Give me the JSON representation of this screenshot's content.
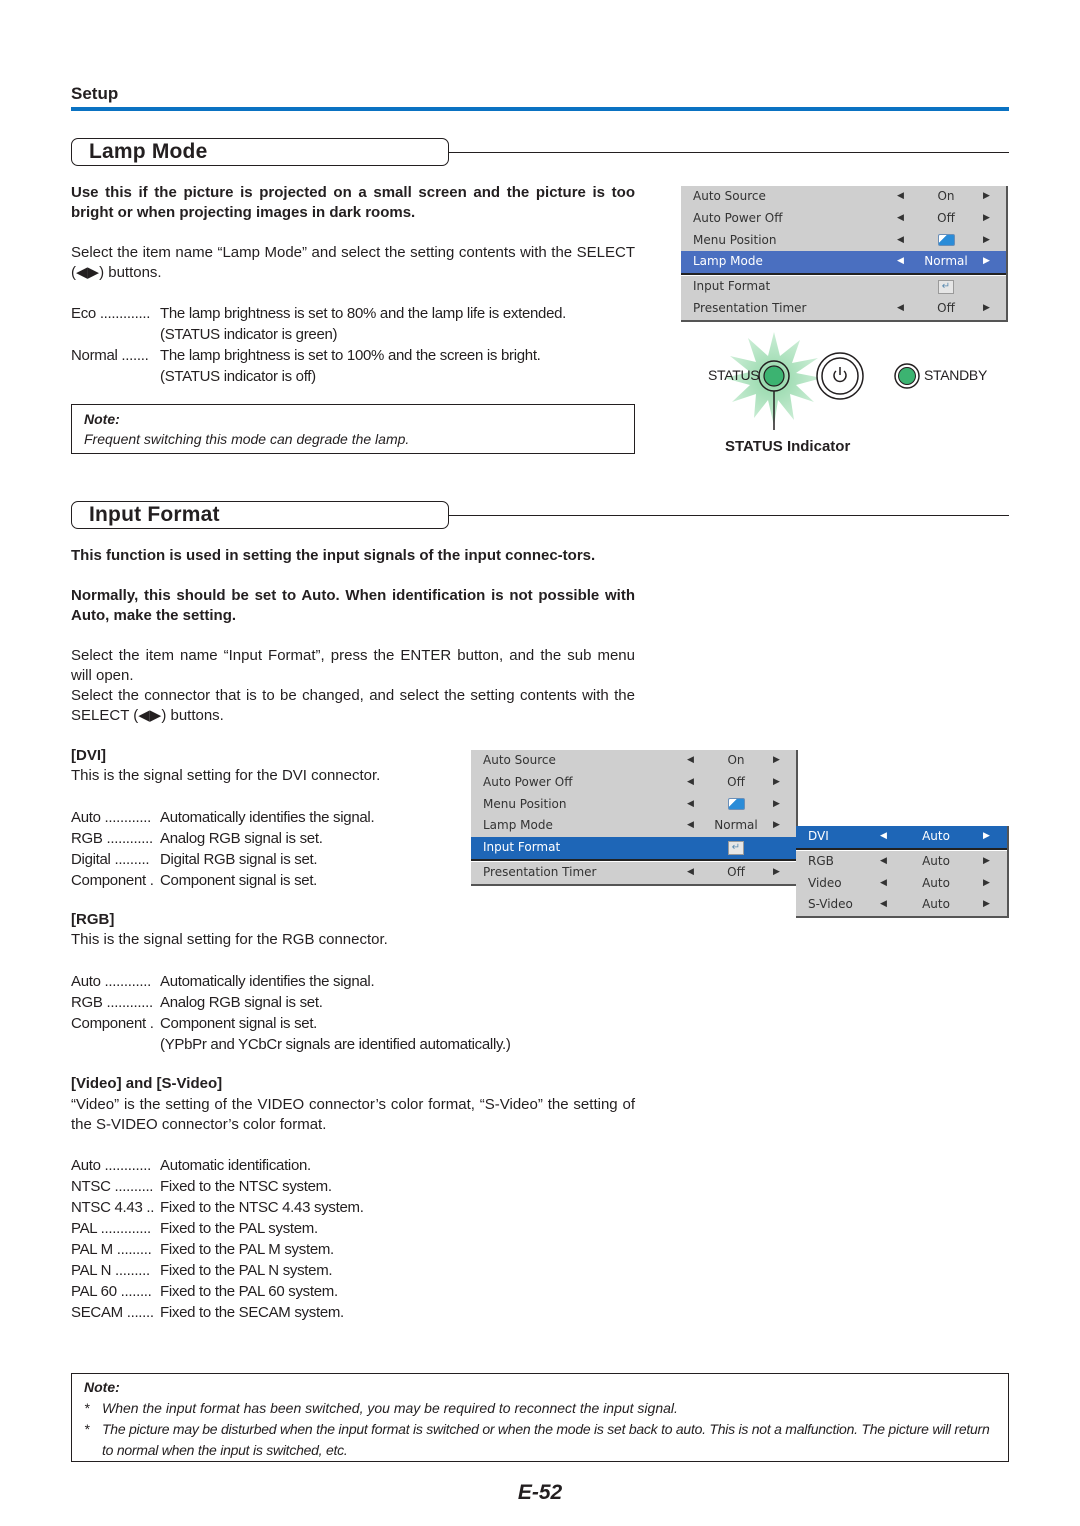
{
  "header": {
    "section": "Setup",
    "rule_color": "#0a72c2"
  },
  "lamp_mode": {
    "title": "Lamp Mode",
    "intro_bold": "Use this if the picture is projected on a small screen and the picture is too bright or when projecting images in dark rooms.",
    "intro": "Select the item name “Lamp Mode” and select the setting contents with the SELECT (◀▶) buttons.",
    "options": [
      {
        "term": "Eco .............",
        "desc": "The lamp brightness is set to 80% and the lamp life is extended.",
        "desc2": "(STATUS indicator is green)"
      },
      {
        "term": "Normal .......",
        "desc": "The lamp brightness is set to 100% and the screen is bright.",
        "desc2": "(STATUS indicator is off)"
      }
    ],
    "note": {
      "title": "Note:",
      "text": "Frequent switching this mode can degrade the lamp."
    },
    "menu": {
      "rows": [
        {
          "label": "Auto Source",
          "left": "◀",
          "value": "On",
          "right": "▶",
          "icon": ""
        },
        {
          "label": "Auto Power Off",
          "left": "◀",
          "value": "Off",
          "right": "▶",
          "icon": ""
        },
        {
          "label": "Menu Position",
          "left": "◀",
          "value": "",
          "right": "▶",
          "icon": "menu-position-icon"
        },
        {
          "label": "Lamp Mode",
          "left": "◀",
          "value": "Normal",
          "right": "▶",
          "icon": "",
          "selected": true
        },
        {
          "label": "Input Format",
          "left": "",
          "value": "↵",
          "right": "",
          "icon": "enter-icon"
        },
        {
          "label": "Presentation Timer",
          "left": "◀",
          "value": "Off",
          "right": "▶",
          "icon": ""
        }
      ],
      "highlight_color": "#4a6fc0"
    },
    "indicator": {
      "status_label": "STATUS",
      "standby_label": "STANDBY",
      "power_icon": "power-icon",
      "caption": "STATUS Indicator",
      "led_color": "#3cb371"
    }
  },
  "input_format": {
    "title": "Input Format",
    "intro_bold_1": "This function is used in setting the input signals of the input connec-tors.",
    "intro_bold_2": "Normally, this should be set to Auto. When identification is not possible with Auto, make the setting.",
    "intro_1": "Select the item name “Input Format”, press the ENTER button, and the sub menu will open.",
    "intro_2": "Select the connector that is to be changed, and select the setting contents with the SELECT (◀▶) buttons.",
    "dvi": {
      "heading": "[DVI]",
      "desc": "This is the signal setting for the DVI connector.",
      "options": [
        {
          "term": "Auto ............",
          "desc": "Automatically identifies the signal."
        },
        {
          "term": "RGB ............",
          "desc": "Analog RGB signal is set."
        },
        {
          "term": "Digital .........",
          "desc": "Digital RGB signal is set."
        },
        {
          "term": "Component .",
          "desc": "Component signal is set."
        }
      ]
    },
    "rgb": {
      "heading": "[RGB]",
      "desc": "This is the signal setting for the RGB connector.",
      "options": [
        {
          "term": "Auto ............",
          "desc": "Automatically identifies the signal."
        },
        {
          "term": "RGB ............",
          "desc": "Analog RGB signal is set."
        },
        {
          "term": "Component .",
          "desc": "Component signal is set."
        }
      ],
      "extra": "(YPbPr and YCbCr signals are identified automatically.)"
    },
    "video": {
      "heading": "[Video] and [S-Video]",
      "desc": "“Video” is the setting of the VIDEO connector’s color format, “S-Video” the setting of the S-VIDEO connector’s color format.",
      "options": [
        {
          "term": "Auto ............",
          "desc": "Automatic identification."
        },
        {
          "term": "NTSC ..........",
          "desc": "Fixed to the NTSC system."
        },
        {
          "term": "NTSC 4.43 ..",
          "desc": "Fixed to the NTSC 4.43 system."
        },
        {
          "term": "PAL .............",
          "desc": "Fixed to the PAL system."
        },
        {
          "term": "PAL M .........",
          "desc": "Fixed to the PAL M system."
        },
        {
          "term": "PAL N .........",
          "desc": "Fixed to the PAL N system."
        },
        {
          "term": "PAL 60 ........",
          "desc": "Fixed to the PAL 60 system."
        },
        {
          "term": "SECAM .......",
          "desc": "Fixed to the SECAM system."
        }
      ]
    },
    "menu": {
      "rows": [
        {
          "label": "Auto Source",
          "left": "◀",
          "value": "On",
          "right": "▶",
          "icon": ""
        },
        {
          "label": "Auto Power Off",
          "left": "◀",
          "value": "Off",
          "right": "▶",
          "icon": ""
        },
        {
          "label": "Menu Position",
          "left": "◀",
          "value": "",
          "right": "▶",
          "icon": "menu-position-icon"
        },
        {
          "label": "Lamp Mode",
          "left": "◀",
          "value": "Normal",
          "right": "▶",
          "icon": ""
        },
        {
          "label": "Input Format",
          "left": "",
          "value": "↵",
          "right": "",
          "icon": "enter-icon",
          "selected": true
        },
        {
          "label": "Presentation Timer",
          "left": "◀",
          "value": "Off",
          "right": "▶",
          "icon": ""
        }
      ],
      "submenu": [
        {
          "label": "DVI",
          "left": "◀",
          "value": "Auto",
          "right": "▶",
          "selected": true
        },
        {
          "label": "RGB",
          "left": "◀",
          "value": "Auto",
          "right": "▶"
        },
        {
          "label": "Video",
          "left": "◀",
          "value": "Auto",
          "right": "▶"
        },
        {
          "label": "S-Video",
          "left": "◀",
          "value": "Auto",
          "right": "▶"
        }
      ],
      "highlight_color": "#1e66b7"
    },
    "note": {
      "title": "Note:",
      "items": [
        {
          "bullet": "*",
          "text": "When the input format has been switched, you may be required to reconnect the input signal."
        },
        {
          "bullet": "*",
          "text": "The picture may be disturbed when the input format is switched or when the mode is set back to auto. This is not a malfunction. The picture will return to normal when the input is switched, etc."
        }
      ]
    }
  },
  "footer": {
    "page_number": "E-52"
  }
}
